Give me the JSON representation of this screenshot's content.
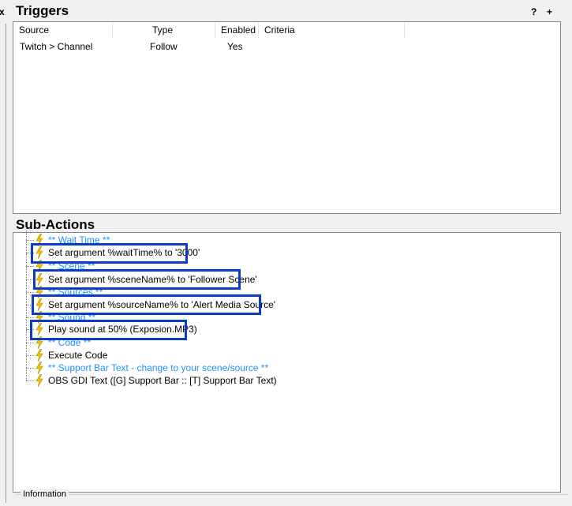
{
  "left": {
    "close_glyph": "x"
  },
  "triggers": {
    "title": "Triggers",
    "help_label": "?",
    "add_label": "+",
    "columns": [
      "Source",
      "Type",
      "Enabled",
      "Criteria"
    ],
    "rows": [
      {
        "source": "Twitch > Channel",
        "type": "Follow",
        "enabled": "Yes",
        "criteria": ""
      }
    ]
  },
  "subactions": {
    "title": "Sub-Actions",
    "items": [
      {
        "label": "** Wait Time **",
        "kind": "comment"
      },
      {
        "label": "Set argument %waitTime% to '3000'",
        "kind": "action"
      },
      {
        "label": "** Scene **",
        "kind": "comment"
      },
      {
        "label": "Set argument %sceneName% to 'Follower Scene'",
        "kind": "action"
      },
      {
        "label": "** Sources **",
        "kind": "comment"
      },
      {
        "label": "Set argument %sourceName% to 'Alert Media Source'",
        "kind": "action"
      },
      {
        "label": "** Sound **",
        "kind": "comment"
      },
      {
        "label": "Play sound at 50% (Exposion.MP3)",
        "kind": "action"
      },
      {
        "label": "** Code **",
        "kind": "comment"
      },
      {
        "label": "Execute Code",
        "kind": "action"
      },
      {
        "label": "** Support Bar Text - change to your scene/source **",
        "kind": "comment"
      },
      {
        "label": "OBS GDI Text ([G] Support Bar :: [T] Support Bar Text)",
        "kind": "action"
      }
    ]
  },
  "information": {
    "label": "Information"
  },
  "colors": {
    "comment": "#1e90ff",
    "highlight": "#0a3cc7",
    "bolt": "#f2c200"
  },
  "icons": {
    "subaction": "lightning-bolt-icon"
  }
}
